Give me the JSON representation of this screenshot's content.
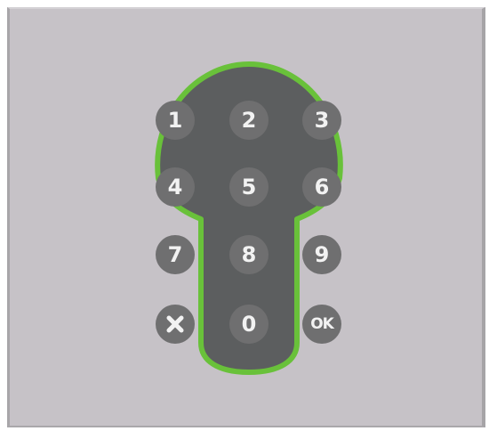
{
  "colors": {
    "background": "#c6c2c7",
    "keyhole_fill": "#5c5e5f",
    "keyhole_outline": "#69c13a",
    "key_fill": "#6f6f70",
    "key_text": "#f2f2f2"
  },
  "keypad": {
    "keys": {
      "k1": "1",
      "k2": "2",
      "k3": "3",
      "k4": "4",
      "k5": "5",
      "k6": "6",
      "k7": "7",
      "k8": "8",
      "k9": "9",
      "k0": "0",
      "ok": "OK"
    },
    "clear_icon": "close-icon"
  }
}
